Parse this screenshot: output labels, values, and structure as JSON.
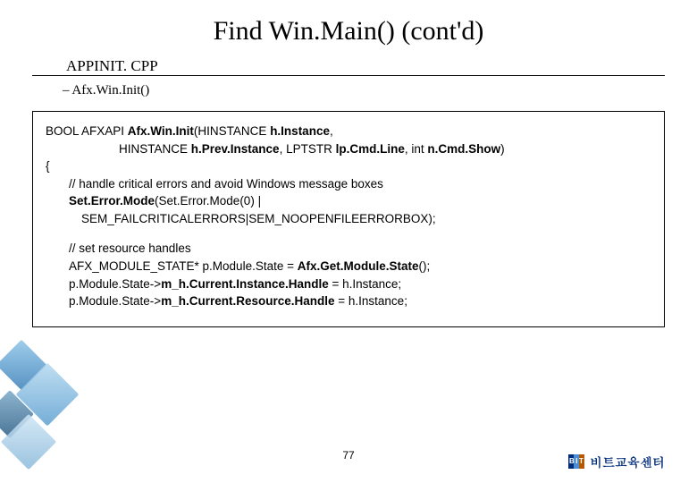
{
  "title": "Find Win.Main() (cont'd)",
  "subhead": "APPINIT. CPP",
  "subitem": "– Afx.Win.Init()",
  "code": {
    "l1a": "BOOL AFXAPI ",
    "l1b": "Afx.Win.Init",
    "l1c": "(HINSTANCE ",
    "l1d": "h.Instance",
    "l1e": ",",
    "l2a": "HINSTANCE ",
    "l2b": "h.Prev.Instance",
    "l2c": ", LPTSTR ",
    "l2d": "lp.Cmd.Line",
    "l2e": ", int ",
    "l2f": "n.Cmd.Show",
    "l2g": ")",
    "l3": "{",
    "l4": "// handle critical errors and avoid Windows message boxes",
    "l5a": "Set.Error.Mode",
    "l5b": "(Set.Error.Mode(0) |",
    "l6": "SEM_FAILCRITICALERRORS|SEM_NOOPENFILEERRORBOX);",
    "l7": "// set resource handles",
    "l8a": "AFX_MODULE_STATE* p.Module.State = ",
    "l8b": "Afx.Get.Module.State",
    "l8c": "();",
    "l9a": "p.Module.State->",
    "l9b": "m_h.Current.Instance.Handle",
    "l9c": " = h.Instance;",
    "l10a": "p.Module.State->",
    "l10b": "m_h.Current.Resource.Handle",
    "l10c": " = h.Instance;"
  },
  "page_number": "77",
  "brand": {
    "logo_letters": "BIT",
    "text": "비트교육센터"
  }
}
